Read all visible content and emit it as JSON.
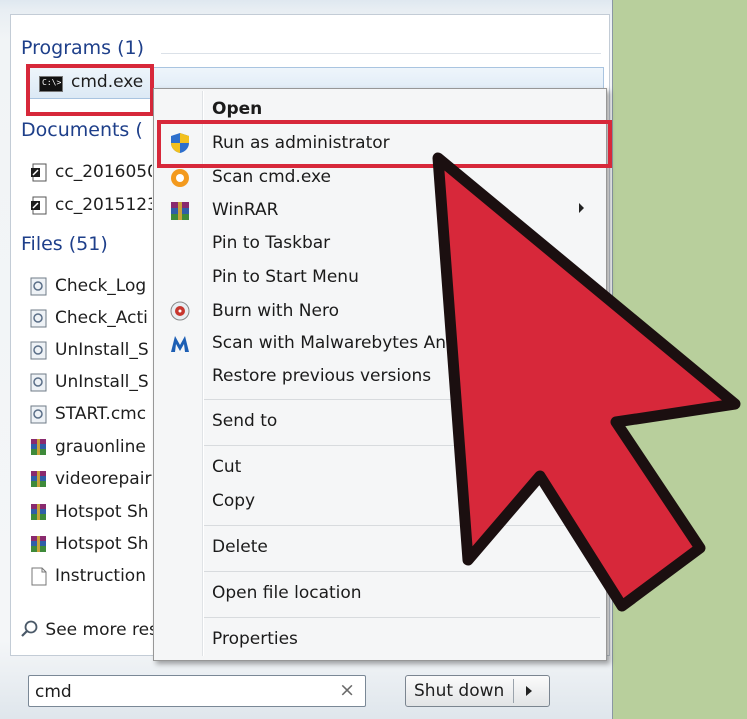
{
  "sections": {
    "programs": {
      "header": "Programs (1)"
    },
    "documents": {
      "header": "Documents ("
    },
    "files": {
      "header": "Files (51)"
    }
  },
  "programs": [
    {
      "label": "cmd.exe",
      "icon": "cmd-console-icon"
    }
  ],
  "documents": [
    {
      "label": "cc_2016050",
      "icon": "document-icon"
    },
    {
      "label": "cc_2015123",
      "icon": "document-icon"
    }
  ],
  "files": [
    {
      "label": "Check_Log",
      "icon": "script-file-icon"
    },
    {
      "label": "Check_Acti",
      "icon": "script-file-icon"
    },
    {
      "label": "UnInstall_S",
      "icon": "script-file-icon"
    },
    {
      "label": "UnInstall_S",
      "icon": "script-file-icon"
    },
    {
      "label": "START.cmc",
      "icon": "script-file-icon"
    },
    {
      "label": "grauonline",
      "icon": "winrar-archive-icon"
    },
    {
      "label": "videorepair",
      "icon": "winrar-archive-icon"
    },
    {
      "label": "Hotspot Sh",
      "icon": "winrar-archive-icon"
    },
    {
      "label": "Hotspot Sh",
      "icon": "winrar-archive-icon"
    },
    {
      "label": "Instruction",
      "icon": "text-file-icon"
    }
  ],
  "see_more": "See more resu",
  "context_menu": {
    "items": [
      {
        "label": "Open",
        "bold": true
      },
      {
        "label": "Run as administrator",
        "icon": "uac-shield-icon"
      },
      {
        "label": "Scan cmd.exe",
        "icon": "avast-icon"
      },
      {
        "label": "WinRAR",
        "icon": "winrar-icon",
        "submenu": true
      },
      {
        "label": "Pin to Taskbar"
      },
      {
        "label": "Pin to Start Menu"
      },
      {
        "label": "Burn with Nero",
        "icon": "nero-icon"
      },
      {
        "label": "Scan with Malwarebytes Ant",
        "icon": "malwarebytes-icon"
      },
      {
        "label": "Restore previous versions"
      },
      {
        "label": "Send to"
      },
      {
        "label": "Cut"
      },
      {
        "label": "Copy"
      },
      {
        "label": "Delete"
      },
      {
        "label": "Open file location"
      },
      {
        "label": "Properties"
      }
    ]
  },
  "search": {
    "value": "cmd",
    "clear": "×"
  },
  "shutdown": {
    "label": "Shut down"
  },
  "colors": {
    "highlight_box": "#d7283a",
    "arrow": "#d7283a",
    "background": "#b8cf9c",
    "header_blue": "#1e3f8a"
  }
}
